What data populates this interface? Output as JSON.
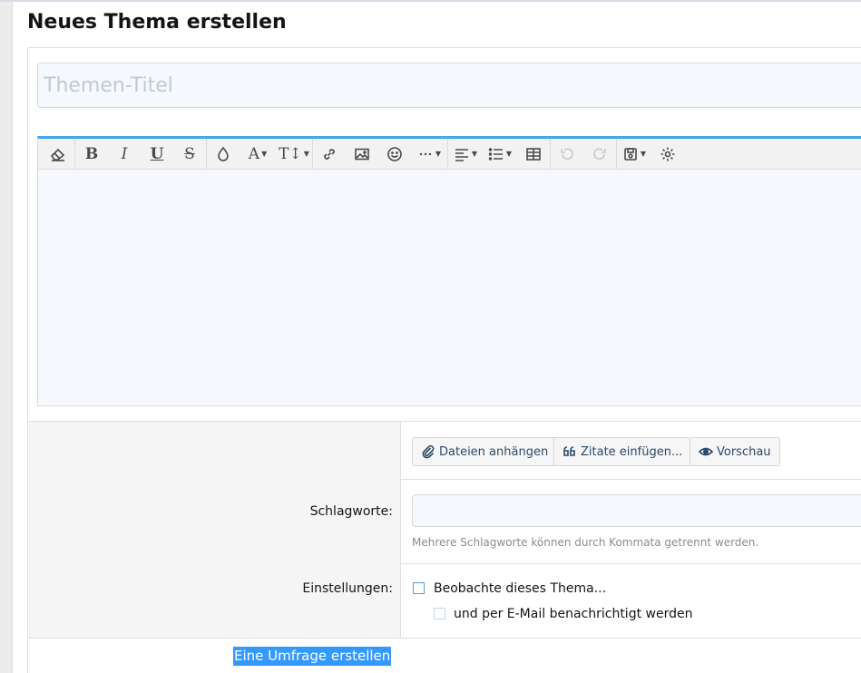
{
  "page": {
    "title": "Neues Thema erstellen"
  },
  "title_field": {
    "placeholder": "Themen-Titel",
    "value": ""
  },
  "editor": {
    "toolbar": {
      "bold_label": "B",
      "italic_label": "I",
      "underline_label": "U",
      "strike_label": "S",
      "font_color_label": "A",
      "font_size_label": "T↕"
    },
    "content": ""
  },
  "actions": {
    "attach_label": "Dateien anhängen",
    "quotes_label": "Zitate einfügen...",
    "preview_label": "Vorschau"
  },
  "tags": {
    "label": "Schlagworte:",
    "value": "",
    "hint": "Mehrere Schlagworte können durch Kommata getrennt werden."
  },
  "settings": {
    "label": "Einstellungen:",
    "watch_label": "Beobachte dieses Thema...",
    "email_label": "und per E-Mail benachrichtigt werden"
  },
  "poll": {
    "label": "Eine Umfrage erstellen"
  },
  "colors": {
    "accent": "#47a7eb",
    "selection": "#3399ff",
    "field_bg": "#f5f9fd"
  }
}
